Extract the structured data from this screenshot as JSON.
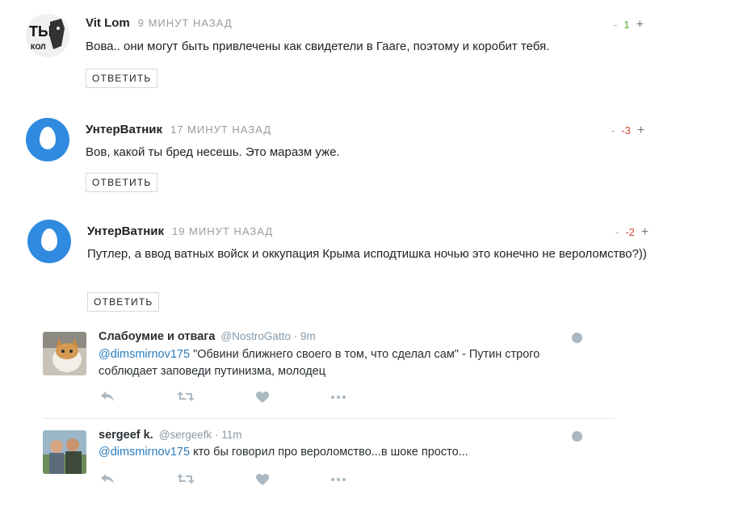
{
  "comments": [
    {
      "author": "Vit Lom",
      "time": "9 МИНУТ НАЗАД",
      "text": "Вова.. они могут быть привлечены как свидетели в Гааге, поэтому и коробит тебя.",
      "reply_label": "ОТВЕТИТЬ",
      "vote_minus": "-",
      "vote_score": "1",
      "vote_plus": "+",
      "score_color": "#5fae28",
      "avatar_text": "ТЫ КОЛ"
    },
    {
      "author": "УнтерВатник",
      "time": "17 МИНУТ НАЗАД",
      "text": "Вов, какой ты бред несешь. Это маразм уже.",
      "reply_label": "ОТВЕТИТЬ",
      "vote_minus": "-",
      "vote_score": "-3",
      "vote_plus": "+",
      "score_color": "#d14836"
    },
    {
      "author": "УнтерВатник",
      "time": "19 МИНУТ НАЗАД",
      "text": "Путлер, а ввод ватных войск и оккупация Крыма исподтишка ночью это конечно не вероломство?))",
      "reply_label": "ОТВЕТИТЬ",
      "vote_minus": "-",
      "vote_score": "-2",
      "vote_plus": "+",
      "score_color": "#d14836"
    }
  ],
  "tweets": [
    {
      "name": "Слабоумие и отвага",
      "handle": "@NostroGatto · 9m",
      "mention": "@dimsmirnov175",
      "text": " \"Обвини ближнего своего в том, что сделал сам\" - Путин строго соблюдает заповеди путинизма, молодец"
    },
    {
      "name": "sergeef k.",
      "handle": "@sergeefk · 11m",
      "mention": "@dimsmirnov175",
      "text": " кто бы говорил про вероломство...в шоке просто..."
    }
  ],
  "icons": {
    "reply": "reply-icon",
    "retweet": "retweet-icon",
    "like": "heart-icon",
    "more": "more-icon",
    "globe": "globe-icon"
  },
  "colors": {
    "twitter_egg_bg": "#2f8ae0",
    "mention": "#2b7bb9",
    "positive": "#5fae28",
    "negative": "#d14836"
  }
}
